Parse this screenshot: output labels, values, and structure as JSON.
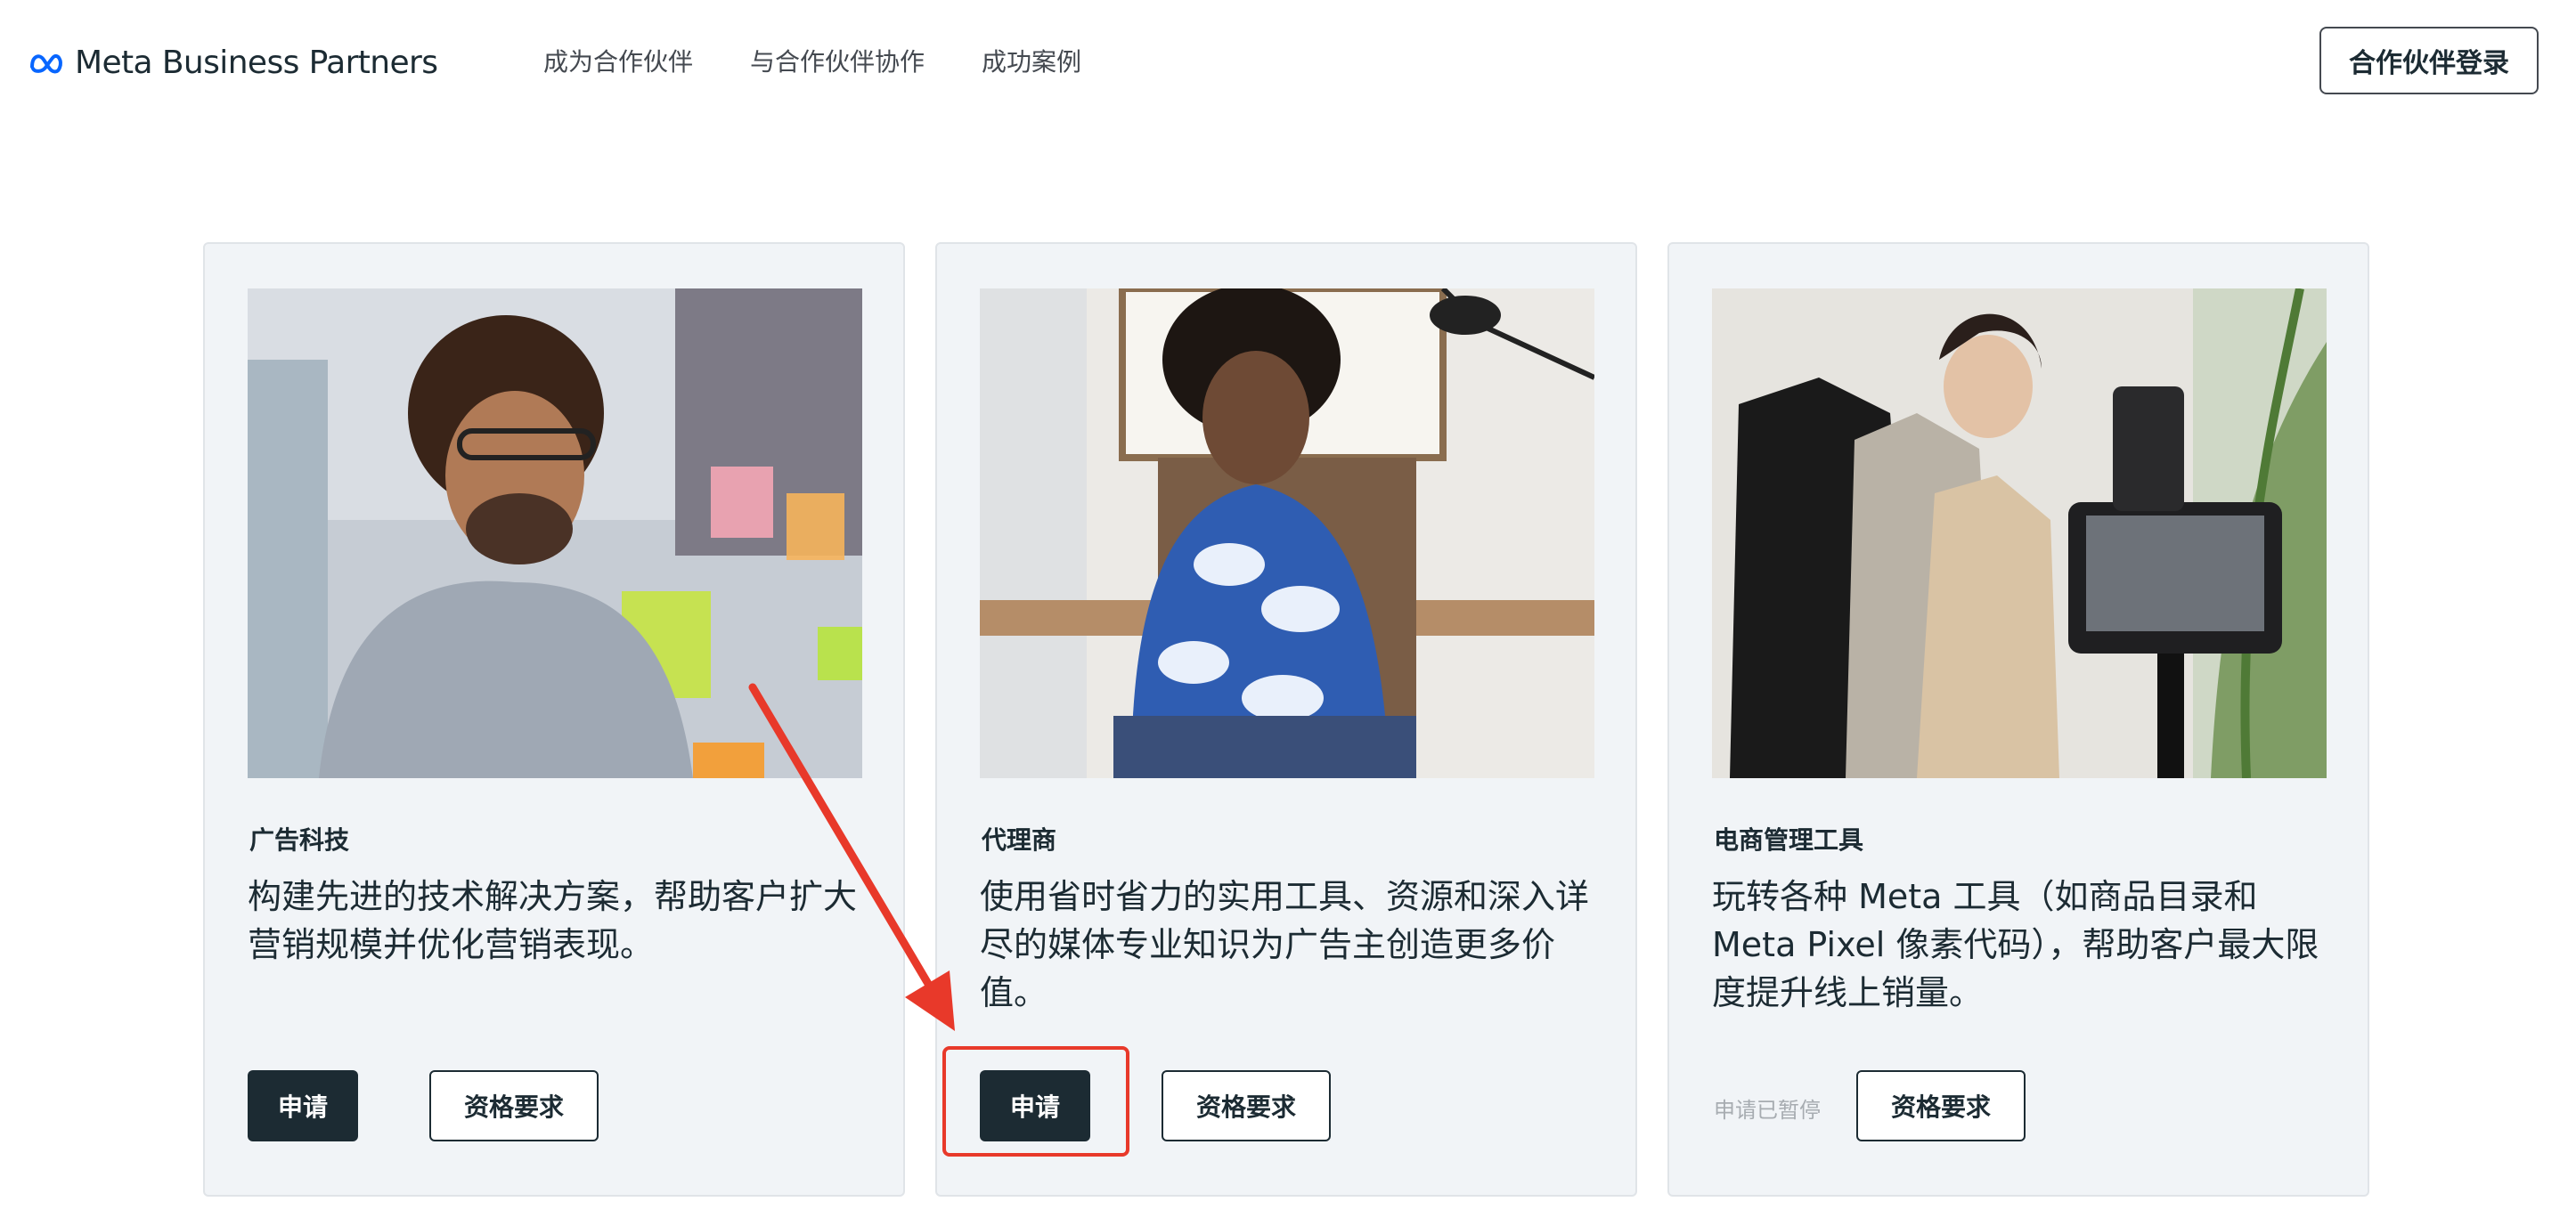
{
  "header": {
    "logo_text": "Meta Business Partners",
    "nav": [
      "成为合作伙伴",
      "与合作伙伴协作",
      "成功案例"
    ],
    "login_label": "合作伙伴登录"
  },
  "cards": [
    {
      "title": "广告科技",
      "description": "构建先进的技术解决方案，帮助客户扩大营销规模并优化营销表现。",
      "apply_label": "申请",
      "requirements_label": "资格要求"
    },
    {
      "title": "代理商",
      "description": "使用省时省力的实用工具、资源和深入详尽的媒体专业知识为广告主创造更多价值。",
      "apply_label": "申请",
      "requirements_label": "资格要求"
    },
    {
      "title": "电商管理工具",
      "description": "玩转各种 Meta 工具（如商品目录和 Meta Pixel 像素代码），帮助客户最大限度提升线上销量。",
      "paused_label": "申请已暂停",
      "requirements_label": "资格要求"
    }
  ],
  "colors": {
    "brand_blue": "#0866ff",
    "dark_button": "#1c2b33",
    "card_bg": "#f1f4f7",
    "annotation_red": "#e8392a"
  },
  "icons": [
    "meta-logo-icon"
  ]
}
